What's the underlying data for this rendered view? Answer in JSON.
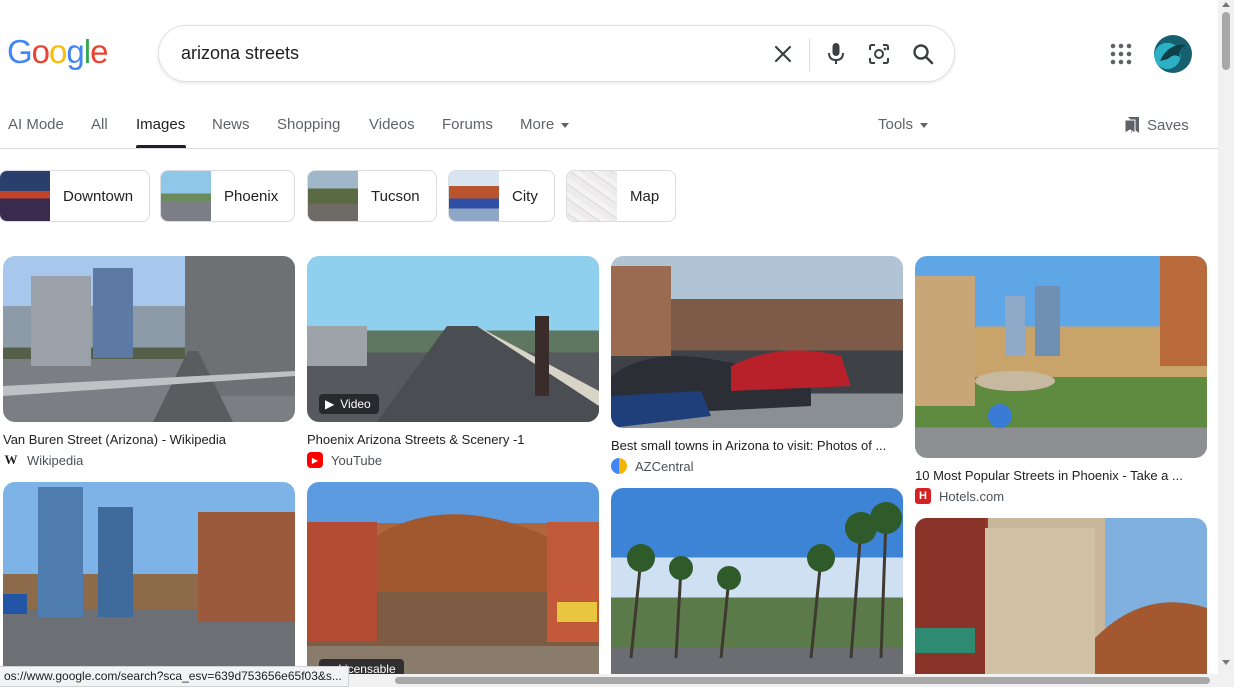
{
  "logo": {
    "letters": [
      "G",
      "o",
      "o",
      "g",
      "l",
      "e"
    ],
    "colors": [
      "#4285f4",
      "#ea4335",
      "#fbbc05",
      "#4285f4",
      "#34a853",
      "#ea4335"
    ]
  },
  "search": {
    "query": "arizona streets"
  },
  "tabs": [
    {
      "label": "AI Mode"
    },
    {
      "label": "All"
    },
    {
      "label": "Images",
      "active": true
    },
    {
      "label": "News"
    },
    {
      "label": "Shopping"
    },
    {
      "label": "Videos"
    },
    {
      "label": "Forums"
    },
    {
      "label": "More"
    }
  ],
  "tools_label": "Tools",
  "saves_label": "Saves",
  "chips": [
    {
      "label": "Downtown"
    },
    {
      "label": "Phoenix"
    },
    {
      "label": "Tucson"
    },
    {
      "label": "City"
    },
    {
      "label": "Map"
    }
  ],
  "results": [
    {
      "title": "Van Buren Street (Arizona) - Wikipedia",
      "source": "Wikipedia",
      "favicon": "wikipedia-icon"
    },
    {
      "title": "Phoenix Arizona Streets & Scenery -1",
      "source": "YouTube",
      "favicon": "youtube-icon",
      "badge": "Video"
    },
    {
      "title": "Best small towns in Arizona to visit: Photos of ...",
      "source": "AZCentral",
      "favicon": "azcentral-icon"
    },
    {
      "title": "10 Most Popular Streets in Phoenix - Take a ...",
      "source": "Hotels.com",
      "favicon": "hotels-icon"
    },
    {
      "title": "",
      "source": ""
    },
    {
      "title": "",
      "source": "",
      "badge": "Licensable"
    },
    {
      "title": "",
      "source": ""
    },
    {
      "title": "",
      "source": ""
    }
  ],
  "status_url": "os://www.google.com/search?sca_esv=639d753656e65f03&s..."
}
